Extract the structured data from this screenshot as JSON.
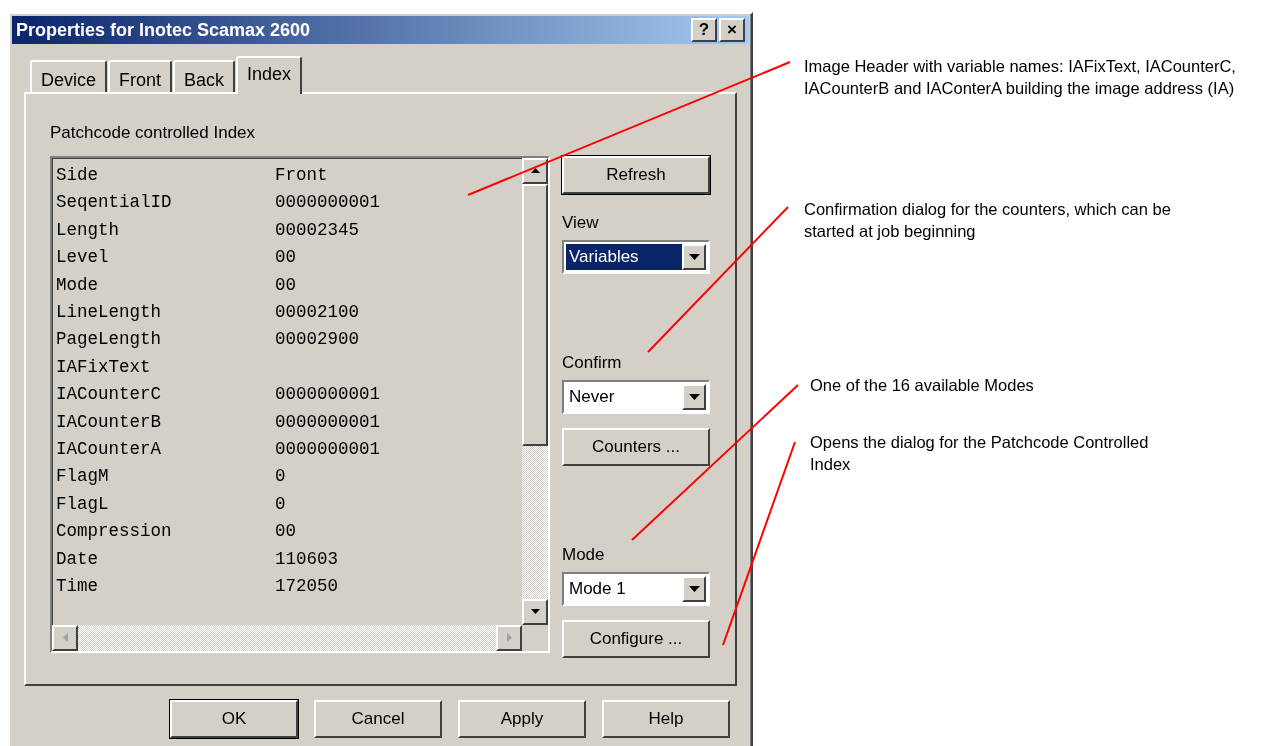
{
  "window": {
    "title": "Properties for Inotec Scamax 2600",
    "help_button": "?",
    "close_button": "×"
  },
  "tabs": [
    {
      "label": "Device",
      "selected": false
    },
    {
      "label": "Front",
      "selected": false
    },
    {
      "label": "Back",
      "selected": false
    },
    {
      "label": "Index",
      "selected": true
    }
  ],
  "group_label": "Patchcode controlled Index",
  "variables": [
    {
      "name": "Side",
      "value": "Front"
    },
    {
      "name": "SeqentialID",
      "value": "0000000001"
    },
    {
      "name": "Length",
      "value": "00002345"
    },
    {
      "name": "Level",
      "value": "00"
    },
    {
      "name": "Mode",
      "value": "00"
    },
    {
      "name": "LineLength",
      "value": "00002100"
    },
    {
      "name": "PageLength",
      "value": "00002900"
    },
    {
      "name": "IAFixText"
    },
    {
      "name": "IACounterC",
      "value": "0000000001"
    },
    {
      "name": "IACounterB",
      "value": "0000000001"
    },
    {
      "name": "IACounterA",
      "value": "0000000001"
    },
    {
      "name": "FlagM",
      "value": "0"
    },
    {
      "name": "FlagL",
      "value": "0"
    },
    {
      "name": "Compression",
      "value": "00"
    },
    {
      "name": "Date",
      "value": "110603"
    },
    {
      "name": "Time",
      "value": "172050"
    }
  ],
  "side_controls": [
    {
      "kind": "button",
      "label": "Refresh",
      "default": true
    },
    {
      "kind": "label",
      "label": "View"
    },
    {
      "kind": "dropdown",
      "value": "Variables",
      "highlighted": true
    },
    {
      "kind": "spacer"
    },
    {
      "kind": "label",
      "label": "Confirm"
    },
    {
      "kind": "dropdown",
      "value": "Never",
      "highlighted": false
    },
    {
      "kind": "button",
      "label": "Counters ...",
      "default": false
    },
    {
      "kind": "spacer"
    },
    {
      "kind": "label",
      "label": "Mode"
    },
    {
      "kind": "dropdown",
      "value": "Mode 1",
      "highlighted": false
    },
    {
      "kind": "button",
      "label": "Configure ...",
      "default": false
    }
  ],
  "footer_buttons": [
    {
      "label": "OK",
      "default": true
    },
    {
      "label": "Cancel",
      "default": false
    },
    {
      "label": "Apply",
      "default": false
    },
    {
      "label": "Help",
      "default": false
    }
  ],
  "annotations": [
    {
      "text": "Image Header with variable names: IAFixText, IACounterC, IACounterB  and IAConterA building the image address (IA)"
    },
    {
      "text": "Confirmation dialog for the counters, which can be started at job beginning"
    },
    {
      "text": "One of the 16 available Modes"
    },
    {
      "text": "Opens the dialog for the Patchcode Controlled Index"
    }
  ]
}
